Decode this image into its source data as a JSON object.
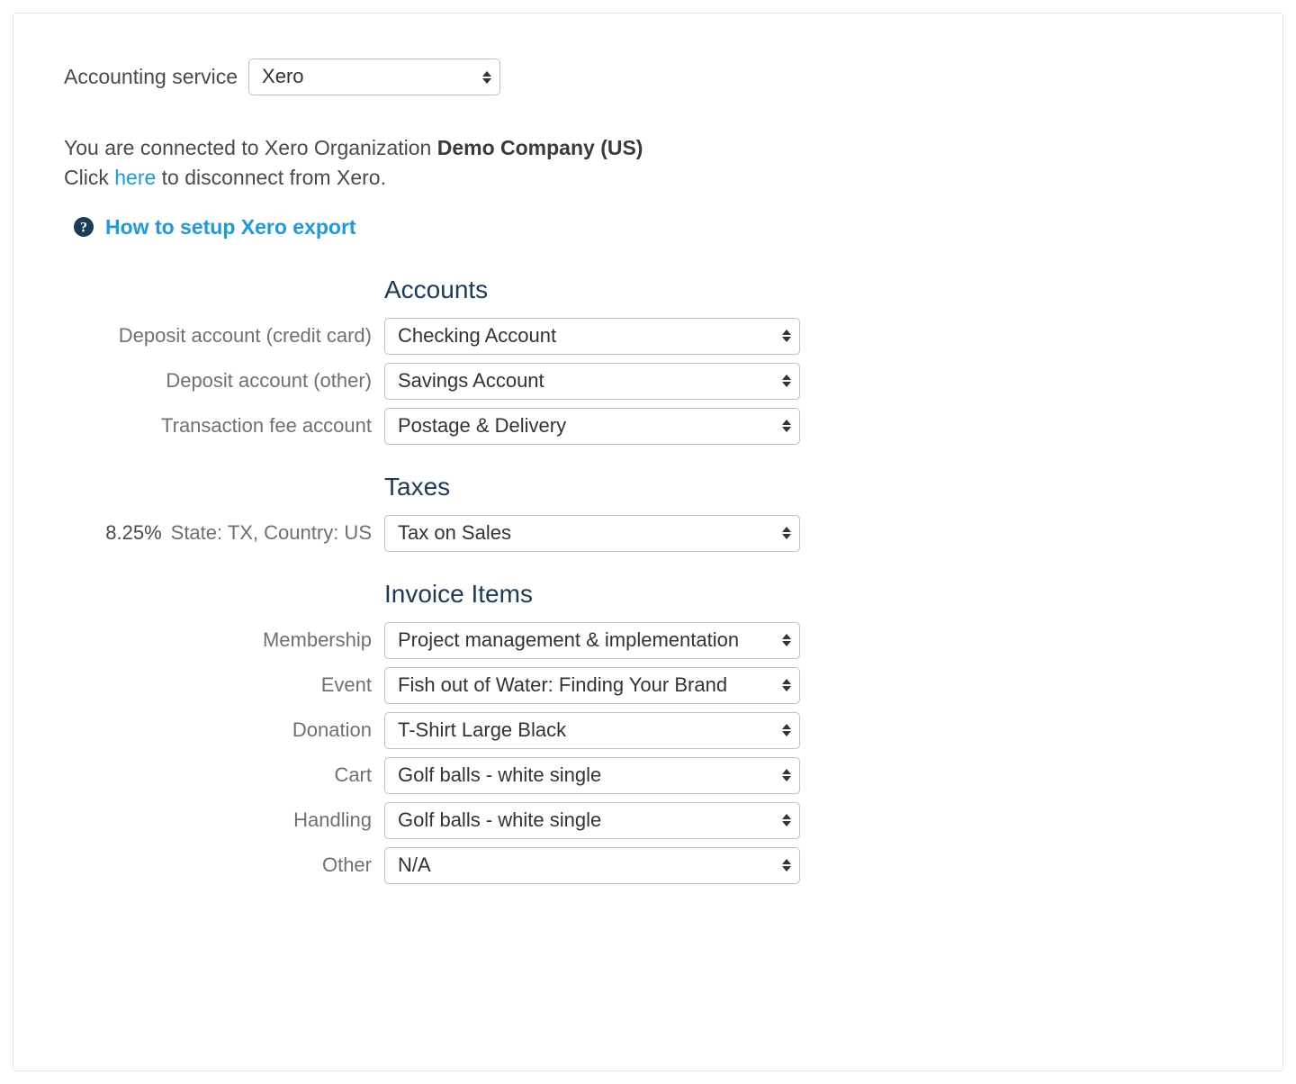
{
  "top": {
    "label": "Accounting service",
    "value": "Xero"
  },
  "status": {
    "prefix": "You are connected to Xero Organization ",
    "org_name": "Demo Company (US)",
    "click_word": "Click ",
    "here_link": "here",
    "suffix": " to disconnect from Xero."
  },
  "help": {
    "link_text": "How to setup Xero export"
  },
  "sections": {
    "accounts": {
      "heading": "Accounts",
      "rows": [
        {
          "label": "Deposit account (credit card)",
          "value": "Checking Account"
        },
        {
          "label": "Deposit account (other)",
          "value": "Savings Account"
        },
        {
          "label": "Transaction fee account",
          "value": "Postage & Delivery"
        }
      ]
    },
    "taxes": {
      "heading": "Taxes",
      "rows": [
        {
          "pct": "8.25%",
          "desc": "State: TX, Country: US",
          "value": "Tax on Sales"
        }
      ]
    },
    "invoice_items": {
      "heading": "Invoice Items",
      "rows": [
        {
          "label": "Membership",
          "value": "Project management & implementation"
        },
        {
          "label": "Event",
          "value": "Fish out of Water: Finding Your Brand"
        },
        {
          "label": "Donation",
          "value": "T-Shirt Large Black"
        },
        {
          "label": "Cart",
          "value": "Golf balls - white single"
        },
        {
          "label": "Handling",
          "value": "Golf balls - white single"
        },
        {
          "label": "Other",
          "value": "N/A"
        }
      ]
    }
  }
}
